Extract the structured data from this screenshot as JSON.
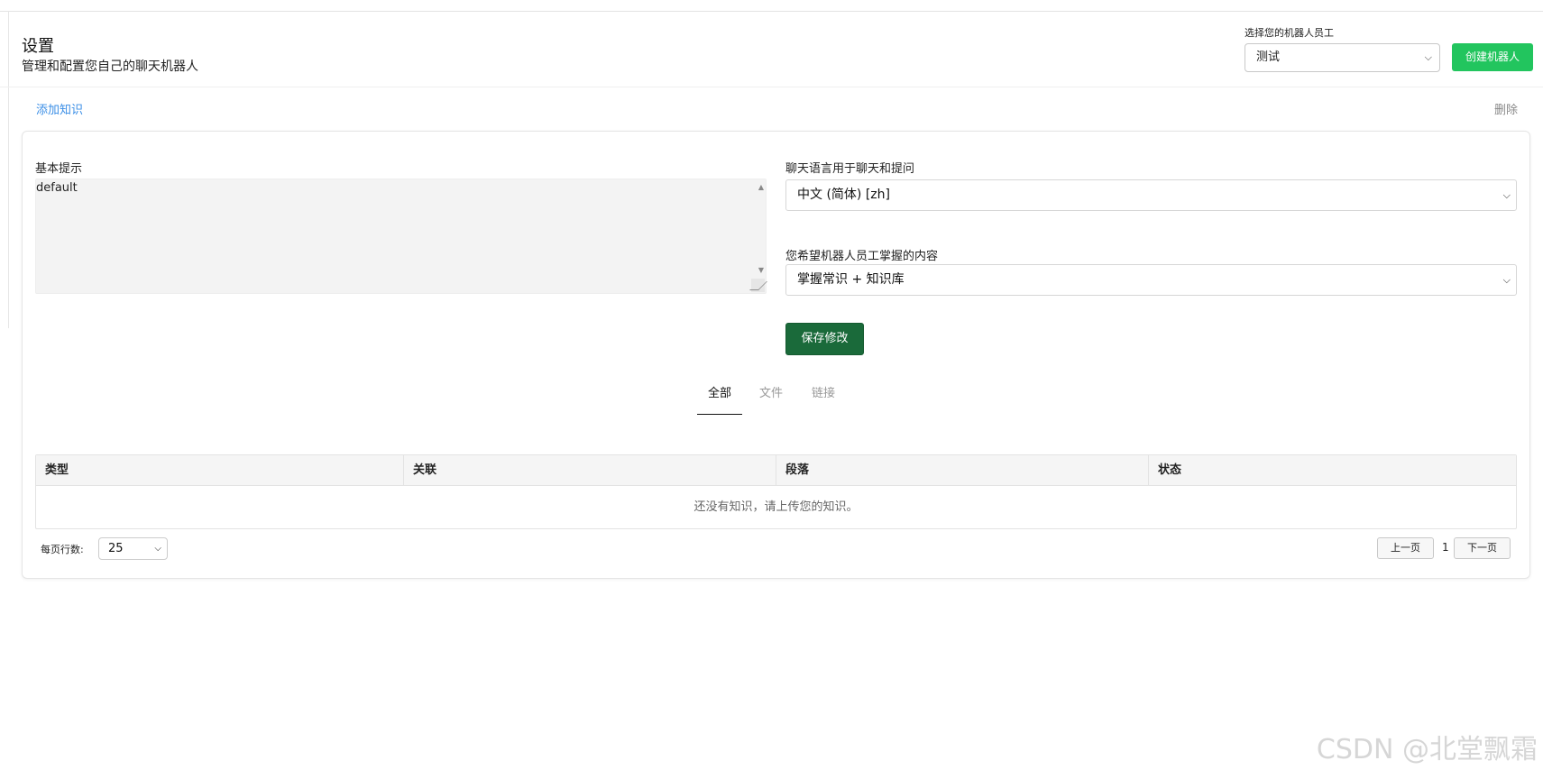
{
  "header": {
    "title": "设置",
    "subtitle": "管理和配置您自己的聊天机器人",
    "bot_select_label": "选择您的机器人员工",
    "bot_select_value": "测试",
    "create_bot_label": "创建机器人"
  },
  "actions": {
    "add_knowledge": "添加知识",
    "delete": "删除"
  },
  "settings": {
    "prompt_label": "基本提示",
    "prompt_value": "default",
    "chat_language_label": "聊天语言用于聊天和提问",
    "chat_language_value": "中文 (简体) [zh]",
    "knowledge_label": "您希望机器人员工掌握的内容",
    "knowledge_value": "掌握常识 + 知识库",
    "save_label": "保存修改"
  },
  "tabs": [
    {
      "label": "全部",
      "active": true
    },
    {
      "label": "文件",
      "active": false
    },
    {
      "label": "链接",
      "active": false
    }
  ],
  "table": {
    "columns": [
      "类型",
      "关联",
      "段落",
      "状态"
    ],
    "empty_message": "还没有知识，请上传您的知识。"
  },
  "pagination": {
    "rows_per_page_label": "每页行数:",
    "rows_per_page_value": "25",
    "prev_label": "上一页",
    "page": "1",
    "next_label": "下一页"
  },
  "watermark": "CSDN @北堂飘霜"
}
